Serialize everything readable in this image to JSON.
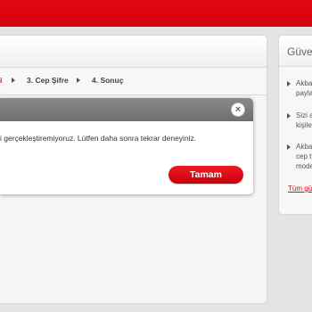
{
  "steps": {
    "step2_tail": "i",
    "step3": "3. Cep Şifre",
    "step4": "4. Sonuç"
  },
  "modal": {
    "close_glyph": "×",
    "message": "i gerçekleştiremiyoruz. Lütfen daha sonra tekrar deneyiniz.",
    "ok_label": "Tamam"
  },
  "sidebar": {
    "title": "Güve",
    "items": [
      {
        "lines": [
          "Akba",
          "payla"
        ]
      },
      {
        "lines": [
          "Sizi a",
          "kişile"
        ]
      },
      {
        "lines": [
          "Akba",
          "cep t",
          "mode"
        ]
      }
    ],
    "link": "Tüm gü"
  },
  "colors": {
    "brand_red": "#e30613",
    "modal_header_gray": "#7a7a7a"
  }
}
